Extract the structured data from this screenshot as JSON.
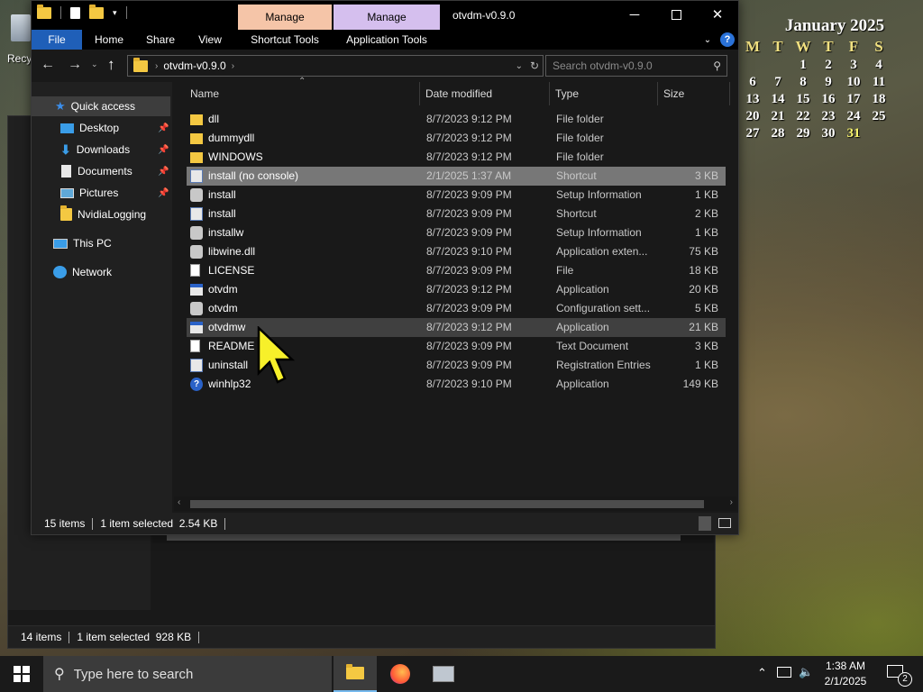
{
  "desktop": {
    "recycle_label": "Recy",
    "calendar": {
      "title": "January 2025",
      "dows": [
        "M",
        "T",
        "W",
        "T",
        "F",
        "S"
      ],
      "rows": [
        [
          "",
          "",
          "1",
          "2",
          "3",
          "4"
        ],
        [
          "6",
          "7",
          "8",
          "9",
          "10",
          "11"
        ],
        [
          "13",
          "14",
          "15",
          "16",
          "17",
          "18"
        ],
        [
          "20",
          "21",
          "22",
          "23",
          "24",
          "25"
        ],
        [
          "27",
          "28",
          "29",
          "30",
          "31",
          ""
        ]
      ],
      "today": "31"
    }
  },
  "back_window": {
    "status": {
      "items": "14 items",
      "selected": "1 item selected  928 KB"
    }
  },
  "window": {
    "title": "otvdm-v0.9.0",
    "context_tabs": [
      {
        "label": "Manage",
        "color": "#f5c5a8"
      },
      {
        "label": "Manage",
        "color": "#d5bfee"
      }
    ],
    "ribbon_tabs": [
      "File",
      "Home",
      "Share",
      "View",
      "Shortcut Tools",
      "Application Tools"
    ],
    "address": {
      "path": "otvdm-v0.9.0"
    },
    "search": {
      "placeholder": "Search otvdm-v0.9.0"
    },
    "nav": {
      "quick_access": "Quick access",
      "items": [
        "Desktop",
        "Downloads",
        "Documents",
        "Pictures",
        "NvidiaLogging"
      ],
      "this_pc": "This PC",
      "network": "Network"
    },
    "columns": {
      "name": "Name",
      "date": "Date modified",
      "type": "Type",
      "size": "Size"
    },
    "files": [
      {
        "name": "dll",
        "date": "8/7/2023 9:12 PM",
        "type": "File folder",
        "size": "",
        "icon": "folder-icon"
      },
      {
        "name": "dummydll",
        "date": "8/7/2023 9:12 PM",
        "type": "File folder",
        "size": "",
        "icon": "folder-icon"
      },
      {
        "name": "WINDOWS",
        "date": "8/7/2023 9:12 PM",
        "type": "File folder",
        "size": "",
        "icon": "folder-icon"
      },
      {
        "name": "install (no console)",
        "date": "2/1/2025 1:37 AM",
        "type": "Shortcut",
        "size": "3 KB",
        "icon": "shortcut-icon"
      },
      {
        "name": "install",
        "date": "8/7/2023 9:09 PM",
        "type": "Setup Information",
        "size": "1 KB",
        "icon": "setup-info-icon"
      },
      {
        "name": "install",
        "date": "8/7/2023 9:09 PM",
        "type": "Shortcut",
        "size": "2 KB",
        "icon": "shortcut-icon"
      },
      {
        "name": "installw",
        "date": "8/7/2023 9:09 PM",
        "type": "Setup Information",
        "size": "1 KB",
        "icon": "setup-info-icon"
      },
      {
        "name": "libwine.dll",
        "date": "8/7/2023 9:10 PM",
        "type": "Application exten...",
        "size": "75 KB",
        "icon": "dll-icon"
      },
      {
        "name": "LICENSE",
        "date": "8/7/2023 9:09 PM",
        "type": "File",
        "size": "18 KB",
        "icon": "file-icon"
      },
      {
        "name": "otvdm",
        "date": "8/7/2023 9:12 PM",
        "type": "Application",
        "size": "20 KB",
        "icon": "application-icon"
      },
      {
        "name": "otvdm",
        "date": "8/7/2023 9:09 PM",
        "type": "Configuration sett...",
        "size": "5 KB",
        "icon": "config-icon"
      },
      {
        "name": "otvdmw",
        "date": "8/7/2023 9:12 PM",
        "type": "Application",
        "size": "21 KB",
        "icon": "application-icon"
      },
      {
        "name": "README",
        "date": "8/7/2023 9:09 PM",
        "type": "Text Document",
        "size": "3 KB",
        "icon": "text-document-icon"
      },
      {
        "name": "uninstall",
        "date": "8/7/2023 9:09 PM",
        "type": "Registration Entries",
        "size": "1 KB",
        "icon": "registry-icon"
      },
      {
        "name": "winhlp32",
        "date": "8/7/2023 9:10 PM",
        "type": "Application",
        "size": "149 KB",
        "icon": "help-icon"
      }
    ],
    "selected_index": 3,
    "hover_index": 11,
    "status": {
      "items": "15 items",
      "selected": "1 item selected  2.54 KB"
    }
  },
  "taskbar": {
    "search_placeholder": "Type here to search",
    "time": "1:38 AM",
    "date": "2/1/2025",
    "notification_count": "2"
  }
}
